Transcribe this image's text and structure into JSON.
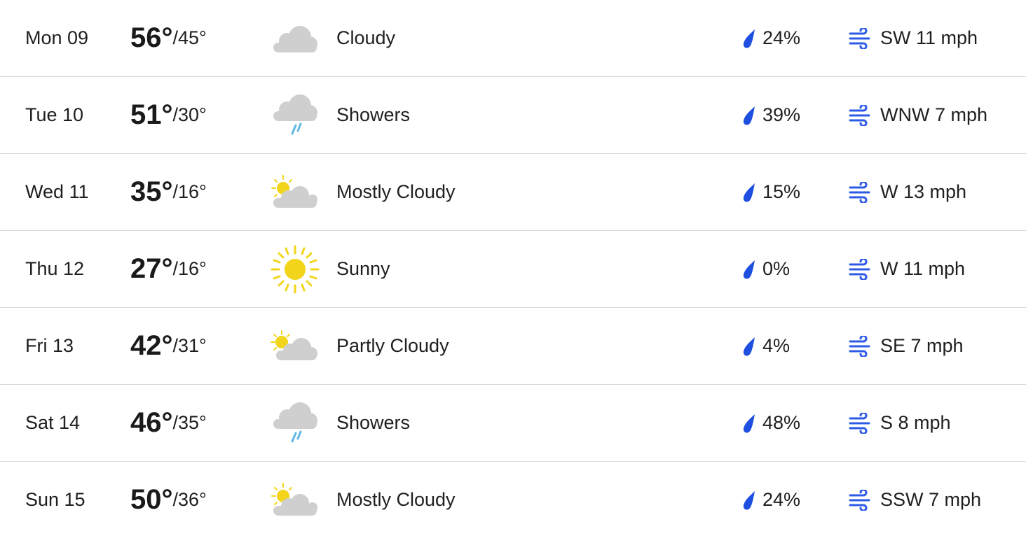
{
  "colors": {
    "divider": "#d9d9d9",
    "precip_icon": "#1f4fe0",
    "wind_icon": "#2e5be6",
    "cloud": "#cfcfcf",
    "sun": "#f2d51a",
    "rain": "#61b8e6"
  },
  "days": [
    {
      "day": "Mon 09",
      "high": "56°",
      "low": "/45°",
      "icon": "cloudy-icon",
      "condition": "Cloudy",
      "precip": "24%",
      "wind": "SW 11 mph"
    },
    {
      "day": "Tue 10",
      "high": "51°",
      "low": "/30°",
      "icon": "showers-icon",
      "condition": "Showers",
      "precip": "39%",
      "wind": "WNW 7 mph"
    },
    {
      "day": "Wed 11",
      "high": "35°",
      "low": "/16°",
      "icon": "mostly-cloudy-icon",
      "condition": "Mostly Cloudy",
      "precip": "15%",
      "wind": "W 13 mph"
    },
    {
      "day": "Thu 12",
      "high": "27°",
      "low": "/16°",
      "icon": "sunny-icon",
      "condition": "Sunny",
      "precip": "0%",
      "wind": "W 11 mph"
    },
    {
      "day": "Fri 13",
      "high": "42°",
      "low": "/31°",
      "icon": "partly-cloudy-icon",
      "condition": "Partly Cloudy",
      "precip": "4%",
      "wind": "SE 7 mph"
    },
    {
      "day": "Sat 14",
      "high": "46°",
      "low": "/35°",
      "icon": "showers-icon",
      "condition": "Showers",
      "precip": "48%",
      "wind": "S 8 mph"
    },
    {
      "day": "Sun 15",
      "high": "50°",
      "low": "/36°",
      "icon": "mostly-cloudy-icon",
      "condition": "Mostly Cloudy",
      "precip": "24%",
      "wind": "SSW 7 mph"
    }
  ]
}
